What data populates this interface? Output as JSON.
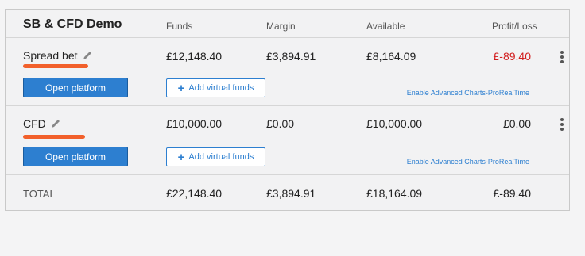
{
  "header": {
    "title": "SB & CFD Demo",
    "columns": [
      "Funds",
      "Margin",
      "Available",
      "Profit/Loss"
    ]
  },
  "accounts": [
    {
      "name": "Spread bet",
      "funds": "£12,148.40",
      "margin": "£3,894.91",
      "available": "£8,164.09",
      "pnl": "£-89.40",
      "open_label": "Open platform",
      "funds_label": "Add virtual funds",
      "advanced_label": "Enable Advanced Charts-ProRealTime"
    },
    {
      "name": "CFD",
      "funds": "£10,000.00",
      "margin": "£0.00",
      "available": "£10,000.00",
      "pnl": "£0.00",
      "open_label": "Open platform",
      "funds_label": "Add virtual funds",
      "advanced_label": "Enable Advanced Charts-ProRealTime"
    }
  ],
  "total": {
    "label": "TOTAL",
    "funds": "£22,148.40",
    "margin": "£3,894.91",
    "available": "£18,164.09",
    "pnl": "£-89.40"
  },
  "colors": {
    "accent": "#2d7fd0",
    "loss": "#d21d1d",
    "redaction": "#f2602b"
  }
}
